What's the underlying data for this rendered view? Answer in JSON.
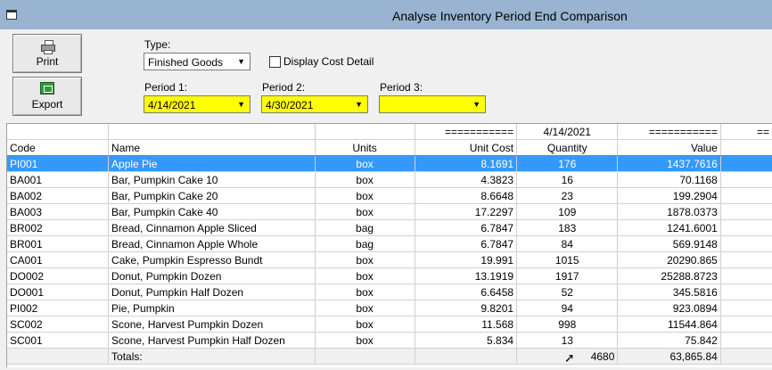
{
  "window": {
    "title": "Analyse Inventory Period End Comparison"
  },
  "toolbar": {
    "print_label": "Print",
    "export_label": "Export"
  },
  "filters": {
    "type_label": "Type:",
    "type_value": "Finished Goods",
    "display_cost_label": "Display Cost Detail",
    "period1_label": "Period 1:",
    "period1_value": "4/14/2021",
    "period2_label": "Period 2:",
    "period2_value": "4/30/2021",
    "period3_label": "Period 3:",
    "period3_value": ""
  },
  "grid": {
    "group_headers": [
      "",
      "",
      "",
      "===========",
      "4/14/2021",
      "===========",
      "=="
    ],
    "columns": [
      "Code",
      "Name",
      "Units",
      "Unit Cost",
      "Quantity",
      "Value",
      ""
    ],
    "rows": [
      [
        "PI001",
        "Apple Pie",
        "box",
        "8.1691",
        "176",
        "1437.7616"
      ],
      [
        "BA001",
        "Bar, Pumpkin Cake 10",
        "box",
        "4.3823",
        "16",
        "70.1168"
      ],
      [
        "BA002",
        "Bar, Pumpkin Cake 20",
        "box",
        "8.6648",
        "23",
        "199.2904"
      ],
      [
        "BA003",
        "Bar, Pumpkin Cake 40",
        "box",
        "17.2297",
        "109",
        "1878.0373"
      ],
      [
        "BR002",
        "Bread, Cinnamon Apple Sliced",
        "bag",
        "6.7847",
        "183",
        "1241.6001"
      ],
      [
        "BR001",
        "Bread, Cinnamon Apple Whole",
        "bag",
        "6.7847",
        "84",
        "569.9148"
      ],
      [
        "CA001",
        "Cake, Pumpkin Espresso Bundt",
        "box",
        "19.991",
        "1015",
        "20290.865"
      ],
      [
        "DO002",
        "Donut, Pumpkin Dozen",
        "box",
        "13.1919",
        "1917",
        "25288.8723"
      ],
      [
        "DO001",
        "Donut, Pumpkin Half Dozen",
        "box",
        "6.6458",
        "52",
        "345.5816"
      ],
      [
        "PI002",
        "Pie, Pumpkin",
        "box",
        "9.8201",
        "94",
        "923.0894"
      ],
      [
        "SC002",
        "Scone, Harvest Pumpkin Dozen",
        "box",
        "11.568",
        "998",
        "11544.864"
      ],
      [
        "SC001",
        "Scone, Harvest Pumpkin Half Dozen",
        "box",
        "5.834",
        "13",
        "75.842"
      ]
    ],
    "totals": {
      "label": "Totals:",
      "quantity": "4680",
      "value": "63,865.84"
    }
  }
}
